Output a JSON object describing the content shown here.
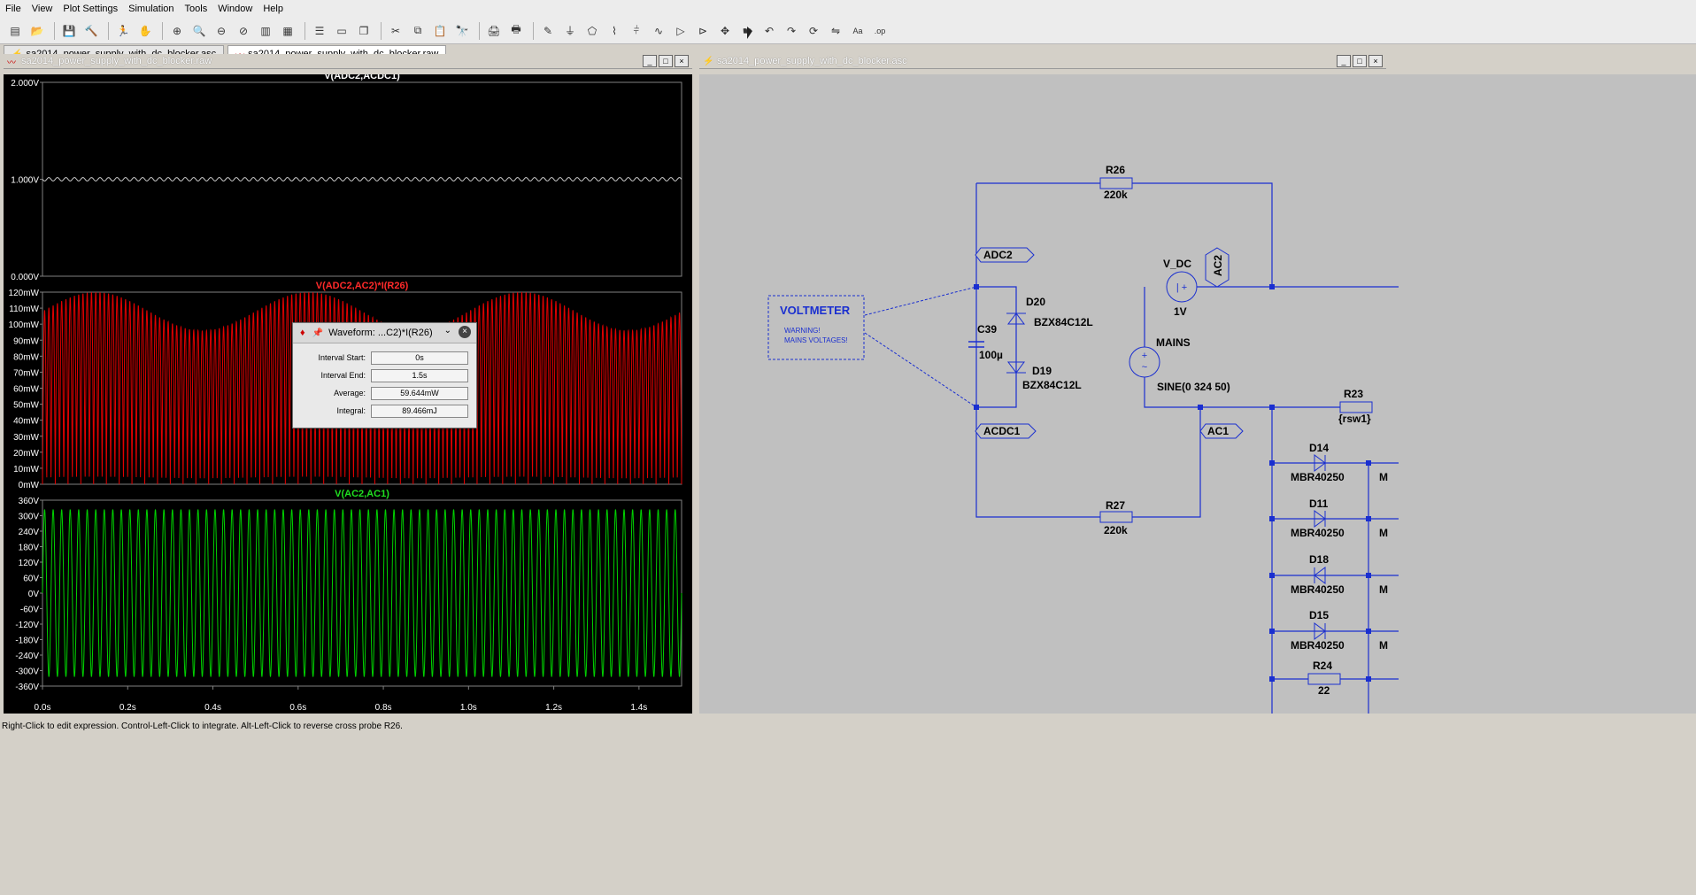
{
  "menu": [
    "File",
    "View",
    "Plot Settings",
    "Simulation",
    "Tools",
    "Window",
    "Help"
  ],
  "toolbar_icons": [
    "new-schematic-icon",
    "open-icon",
    "save-icon",
    "control-panel-icon",
    "run-icon",
    "halt-icon",
    "zoom-in-icon",
    "zoom-area-icon",
    "zoom-out-icon",
    "zoom-cancel-icon",
    "autorange-icon",
    "grid-icon",
    "tile-horizontal-icon",
    "tile-vertical-icon",
    "cascade-icon",
    "cut-icon",
    "copy-icon",
    "paste-icon",
    "find-icon",
    "print-preview-icon",
    "print-icon",
    "wire-icon",
    "ground-icon",
    "label-icon",
    "resistor-icon",
    "capacitor-icon",
    "inductor-icon",
    "diode-icon",
    "component-icon",
    "move-icon",
    "drag-icon",
    "undo-icon",
    "redo-icon",
    "rotate-icon",
    "mirror-icon",
    "text-icon",
    "spice-directive-icon"
  ],
  "tabs": [
    {
      "label": "sa2014_power_supply_with_dc_blocker.asc",
      "icon": "schematic-tab-icon"
    },
    {
      "label": "sa2014_power_supply_with_dc_blocker.raw",
      "icon": "waveform-tab-icon"
    }
  ],
  "wave_panel": {
    "title": "sa2014_power_supply_with_dc_blocker.raw",
    "plots": [
      {
        "title": "V(ADC2,ACDC1)",
        "color": "#ffffff",
        "trace_color": "#c8c8c8",
        "yticks": [
          "2.000V",
          "1.000V",
          "0.000V"
        ],
        "y_values": [
          2.0,
          1.0,
          0.0
        ],
        "trace_level": 1.0
      },
      {
        "title": "V(ADC2,AC2)*I(R26)",
        "color": "#ff2a2a",
        "trace_color": "#e00000",
        "yticks": [
          "120mW",
          "110mW",
          "100mW",
          "90mW",
          "80mW",
          "70mW",
          "60mW",
          "50mW",
          "40mW",
          "30mW",
          "20mW",
          "10mW",
          "0mW"
        ]
      },
      {
        "title": "V(AC2,AC1)",
        "color": "#20e020",
        "trace_color": "#00d000",
        "yticks": [
          "360V",
          "300V",
          "240V",
          "180V",
          "120V",
          "60V",
          "0V",
          "-60V",
          "-120V",
          "-180V",
          "-240V",
          "-300V",
          "-360V"
        ]
      }
    ],
    "xticks": [
      "0.0s",
      "0.2s",
      "0.4s",
      "0.6s",
      "0.8s",
      "1.0s",
      "1.2s",
      "1.4s"
    ],
    "x_values": [
      0.0,
      0.2,
      0.4,
      0.6,
      0.8,
      1.0,
      1.2,
      1.4
    ],
    "x_max": 1.5
  },
  "dialog": {
    "title": "Waveform: ...C2)*I(R26)",
    "rows": [
      {
        "label": "Interval Start:",
        "value": "0s"
      },
      {
        "label": "Interval End:",
        "value": "1.5s"
      },
      {
        "label": "Average:",
        "value": "59.644mW"
      },
      {
        "label": "Integral:",
        "value": "89.466mJ"
      }
    ]
  },
  "schematic_panel": {
    "title": "sa2014_power_supply_with_dc_blocker.asc",
    "voltmeter": {
      "title": "VOLTMETER",
      "warning1": "WARNING!",
      "warning2": "MAINS VOLTAGES!"
    },
    "labels": {
      "r26": "R26",
      "r26v": "220k",
      "r27": "R27",
      "r27v": "220k",
      "adc2": "ADC2",
      "acdc1": "ACDC1",
      "ac1": "AC1",
      "ac2": "AC2",
      "c39": "C39",
      "c39v": "100µ",
      "d20": "D20",
      "d20v": "BZX84C12L",
      "d19": "D19",
      "d19v": "BZX84C12L",
      "vdc": "V_DC",
      "vdcv": "1V",
      "mains": "MAINS",
      "mainsv": "SINE(0 324 50)",
      "r23": "R23",
      "r23v": "{rsw1}",
      "d14": "D14",
      "d14v": "MBR40250",
      "d11": "D11",
      "d11v": "MBR40250",
      "d18": "D18",
      "d18v": "MBR40250",
      "d15": "D15",
      "d15v": "MBR40250",
      "r24": "R24",
      "r24v": "22",
      "m1": "M",
      "m2": "M",
      "m3": "M",
      "m4": "M"
    }
  },
  "status": "Right-Click to edit expression. Control-Left-Click to integrate. Alt-Left-Click to reverse cross probe R26."
}
